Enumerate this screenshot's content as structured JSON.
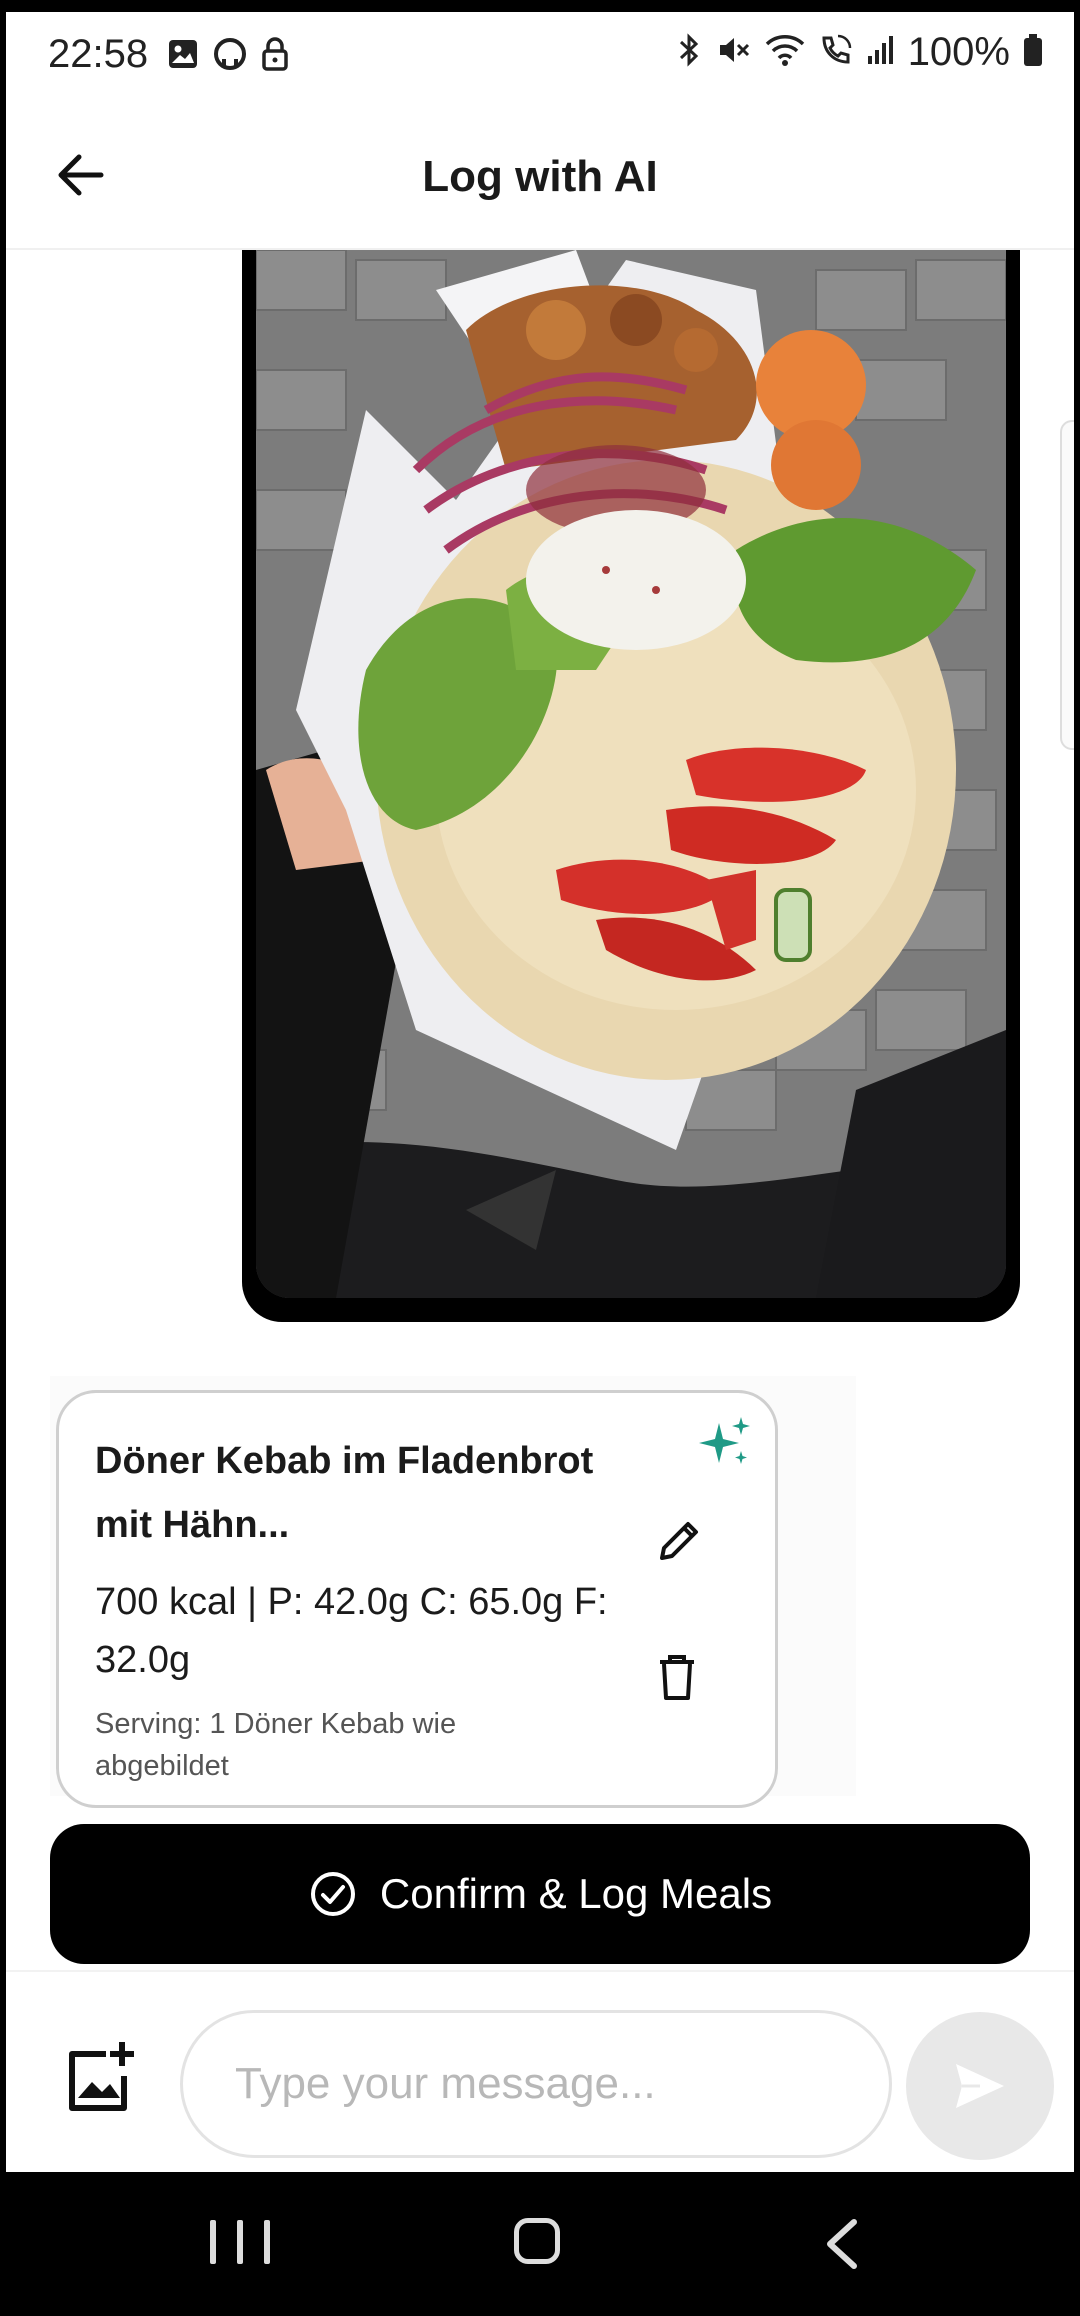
{
  "status_bar": {
    "time": "22:58",
    "left_icons": [
      "gallery-icon",
      "github-icon",
      "lock-icon"
    ],
    "right_icons": [
      "bluetooth-icon",
      "mute-icon",
      "wifi-icon",
      "wifi-call-icon",
      "signal-icon",
      "battery-icon"
    ],
    "battery": "100%"
  },
  "header": {
    "title": "Log with AI",
    "back_icon": "arrow-left-icon"
  },
  "chat": {
    "user_photo": {
      "kind": "food-photo"
    },
    "meal_card": {
      "name": "Döner Kebab im Fladenbrot mit Hähn...",
      "macros": "700 kcal | P: 42.0g C: 65.0g F: 32.0g",
      "serving": "Serving: 1 Döner Kebab wie abgebildet",
      "ai_icon": "sparkles-icon",
      "edit_icon": "pencil-icon",
      "delete_icon": "trash-icon"
    },
    "confirm_button": {
      "label": "Confirm & Log Meals",
      "icon": "check-circle-icon"
    }
  },
  "composer": {
    "placeholder": "Type your message...",
    "value": "",
    "add_image_icon": "add-image-icon",
    "send_icon": "send-icon"
  },
  "nav_bar": {
    "buttons": [
      "recents",
      "home",
      "back"
    ]
  },
  "colors": {
    "accent": "#1a8a7a",
    "button_bg": "#000000",
    "card_border": "#cfcfcf",
    "send_disabled": "#e8e8e8"
  }
}
